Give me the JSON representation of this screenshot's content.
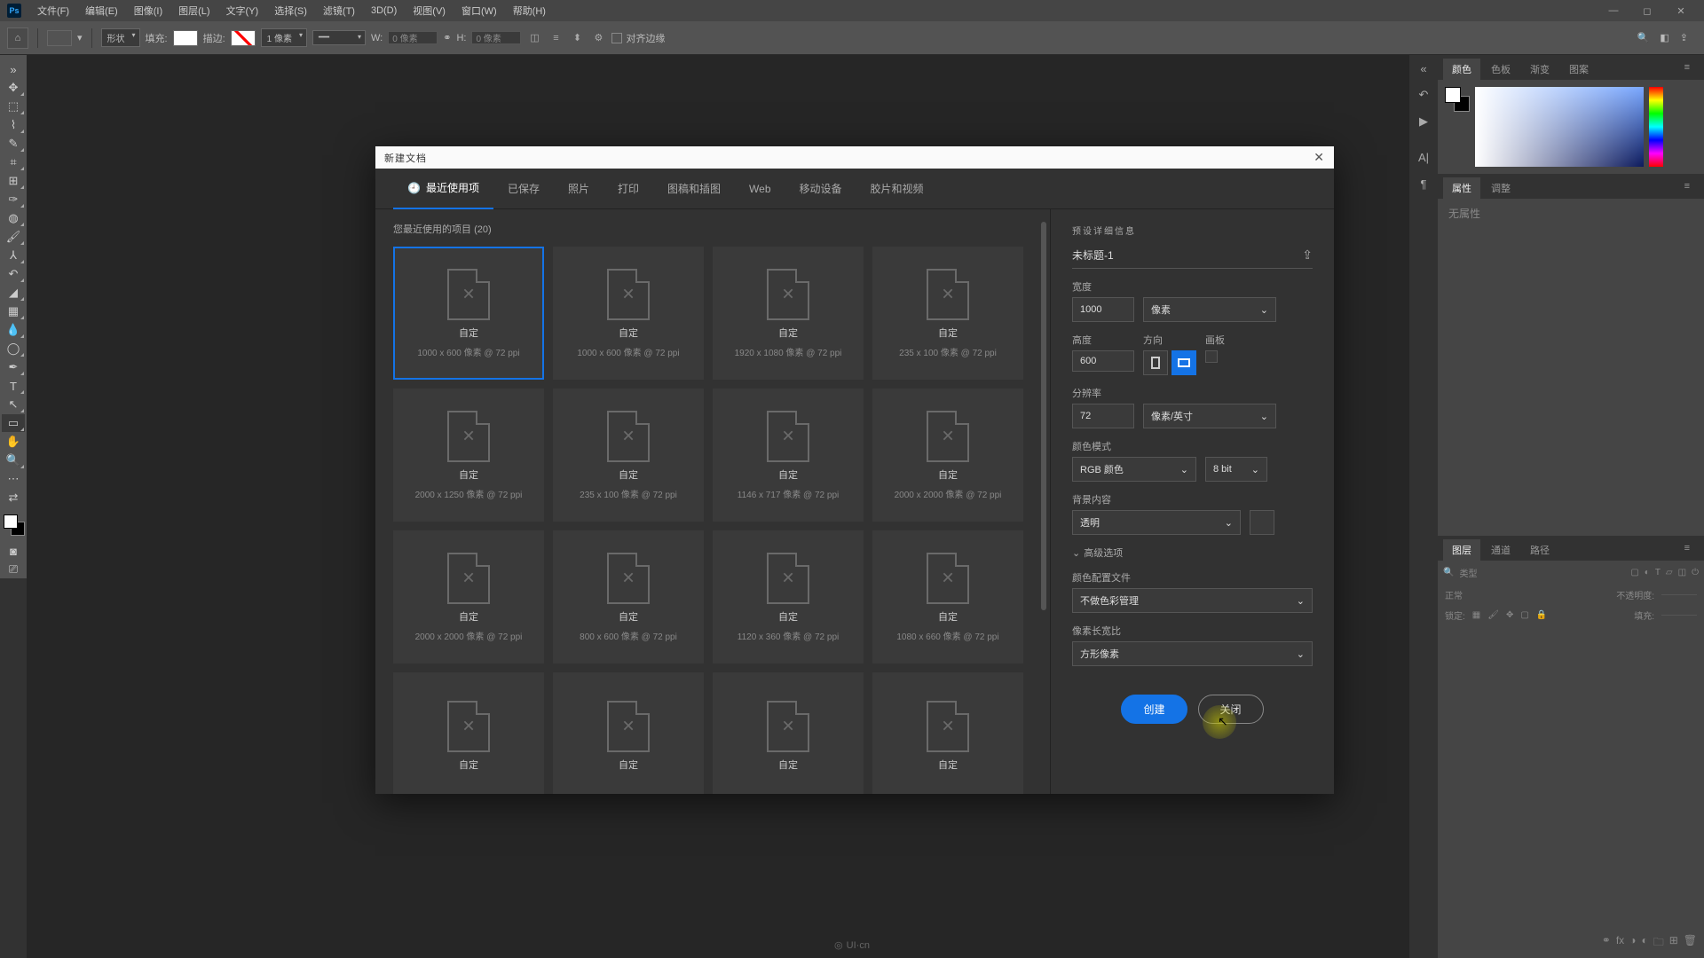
{
  "menu": {
    "file": "文件(F)",
    "edit": "编辑(E)",
    "image": "图像(I)",
    "layer": "图层(L)",
    "type": "文字(Y)",
    "select": "选择(S)",
    "filter": "滤镜(T)",
    "three_d": "3D(D)",
    "view": "视图(V)",
    "window": "窗口(W)",
    "help": "帮助(H)"
  },
  "optbar": {
    "shape": "形状",
    "fill": "填充:",
    "stroke": "描边:",
    "stroke_px": "1 像素",
    "w": "W:",
    "h": "H:",
    "w_val": "0 像素",
    "h_val": "0 像素",
    "align": "对齐边缘"
  },
  "panels": {
    "color": "颜色",
    "swatches": "色板",
    "gradients": "渐变",
    "patterns": "图案",
    "properties": "属性",
    "adjust": "调整",
    "no_props": "无属性",
    "layers": "图层",
    "channels": "通道",
    "paths": "路径",
    "kind": "类型",
    "blend": "正常",
    "opacity": "不透明度:",
    "lock": "锁定:",
    "fill_lbl": "填充:"
  },
  "dialog": {
    "title": "新建文档",
    "tabs": {
      "recent": "最近使用项",
      "saved": "已保存",
      "photo": "照片",
      "print": "打印",
      "art": "图稿和插图",
      "web": "Web",
      "mobile": "移动设备",
      "film": "胶片和视频"
    },
    "recent_count": "(20)",
    "presets_title": "您最近使用的项目",
    "presets": [
      {
        "name": "自定",
        "dim": "1000 x 600 像素 @ 72 ppi"
      },
      {
        "name": "自定",
        "dim": "1000 x 600 像素 @ 72 ppi"
      },
      {
        "name": "自定",
        "dim": "1920 x 1080 像素 @ 72 ppi"
      },
      {
        "name": "自定",
        "dim": "235 x 100 像素 @ 72 ppi"
      },
      {
        "name": "自定",
        "dim": "2000 x 1250 像素 @ 72 ppi"
      },
      {
        "name": "自定",
        "dim": "235 x 100 像素 @ 72 ppi"
      },
      {
        "name": "自定",
        "dim": "1146 x 717 像素 @ 72 ppi"
      },
      {
        "name": "自定",
        "dim": "2000 x 2000 像素 @ 72 ppi"
      },
      {
        "name": "自定",
        "dim": "2000 x 2000 像素 @ 72 ppi"
      },
      {
        "name": "自定",
        "dim": "800 x 600 像素 @ 72 ppi"
      },
      {
        "name": "自定",
        "dim": "1120 x 360 像素 @ 72 ppi"
      },
      {
        "name": "自定",
        "dim": "1080 x 660 像素 @ 72 ppi"
      },
      {
        "name": "自定",
        "dim": ""
      },
      {
        "name": "自定",
        "dim": ""
      },
      {
        "name": "自定",
        "dim": ""
      },
      {
        "name": "自定",
        "dim": ""
      }
    ],
    "details": {
      "head": "预设详细信息",
      "name": "未标题-1",
      "width": "宽度",
      "width_val": "1000",
      "width_unit": "像素",
      "height": "高度",
      "height_val": "600",
      "orient": "方向",
      "artboard": "画板",
      "res": "分辨率",
      "res_val": "72",
      "res_unit": "像素/英寸",
      "mode": "颜色模式",
      "mode_val": "RGB 颜色",
      "bits": "8 bit",
      "bg": "背景内容",
      "bg_val": "透明",
      "adv": "高级选项",
      "profile": "颜色配置文件",
      "profile_val": "不做色彩管理",
      "aspect": "像素长宽比",
      "aspect_val": "方形像素"
    },
    "create": "创建",
    "close": "关闭"
  },
  "watermark": "UI·cn"
}
